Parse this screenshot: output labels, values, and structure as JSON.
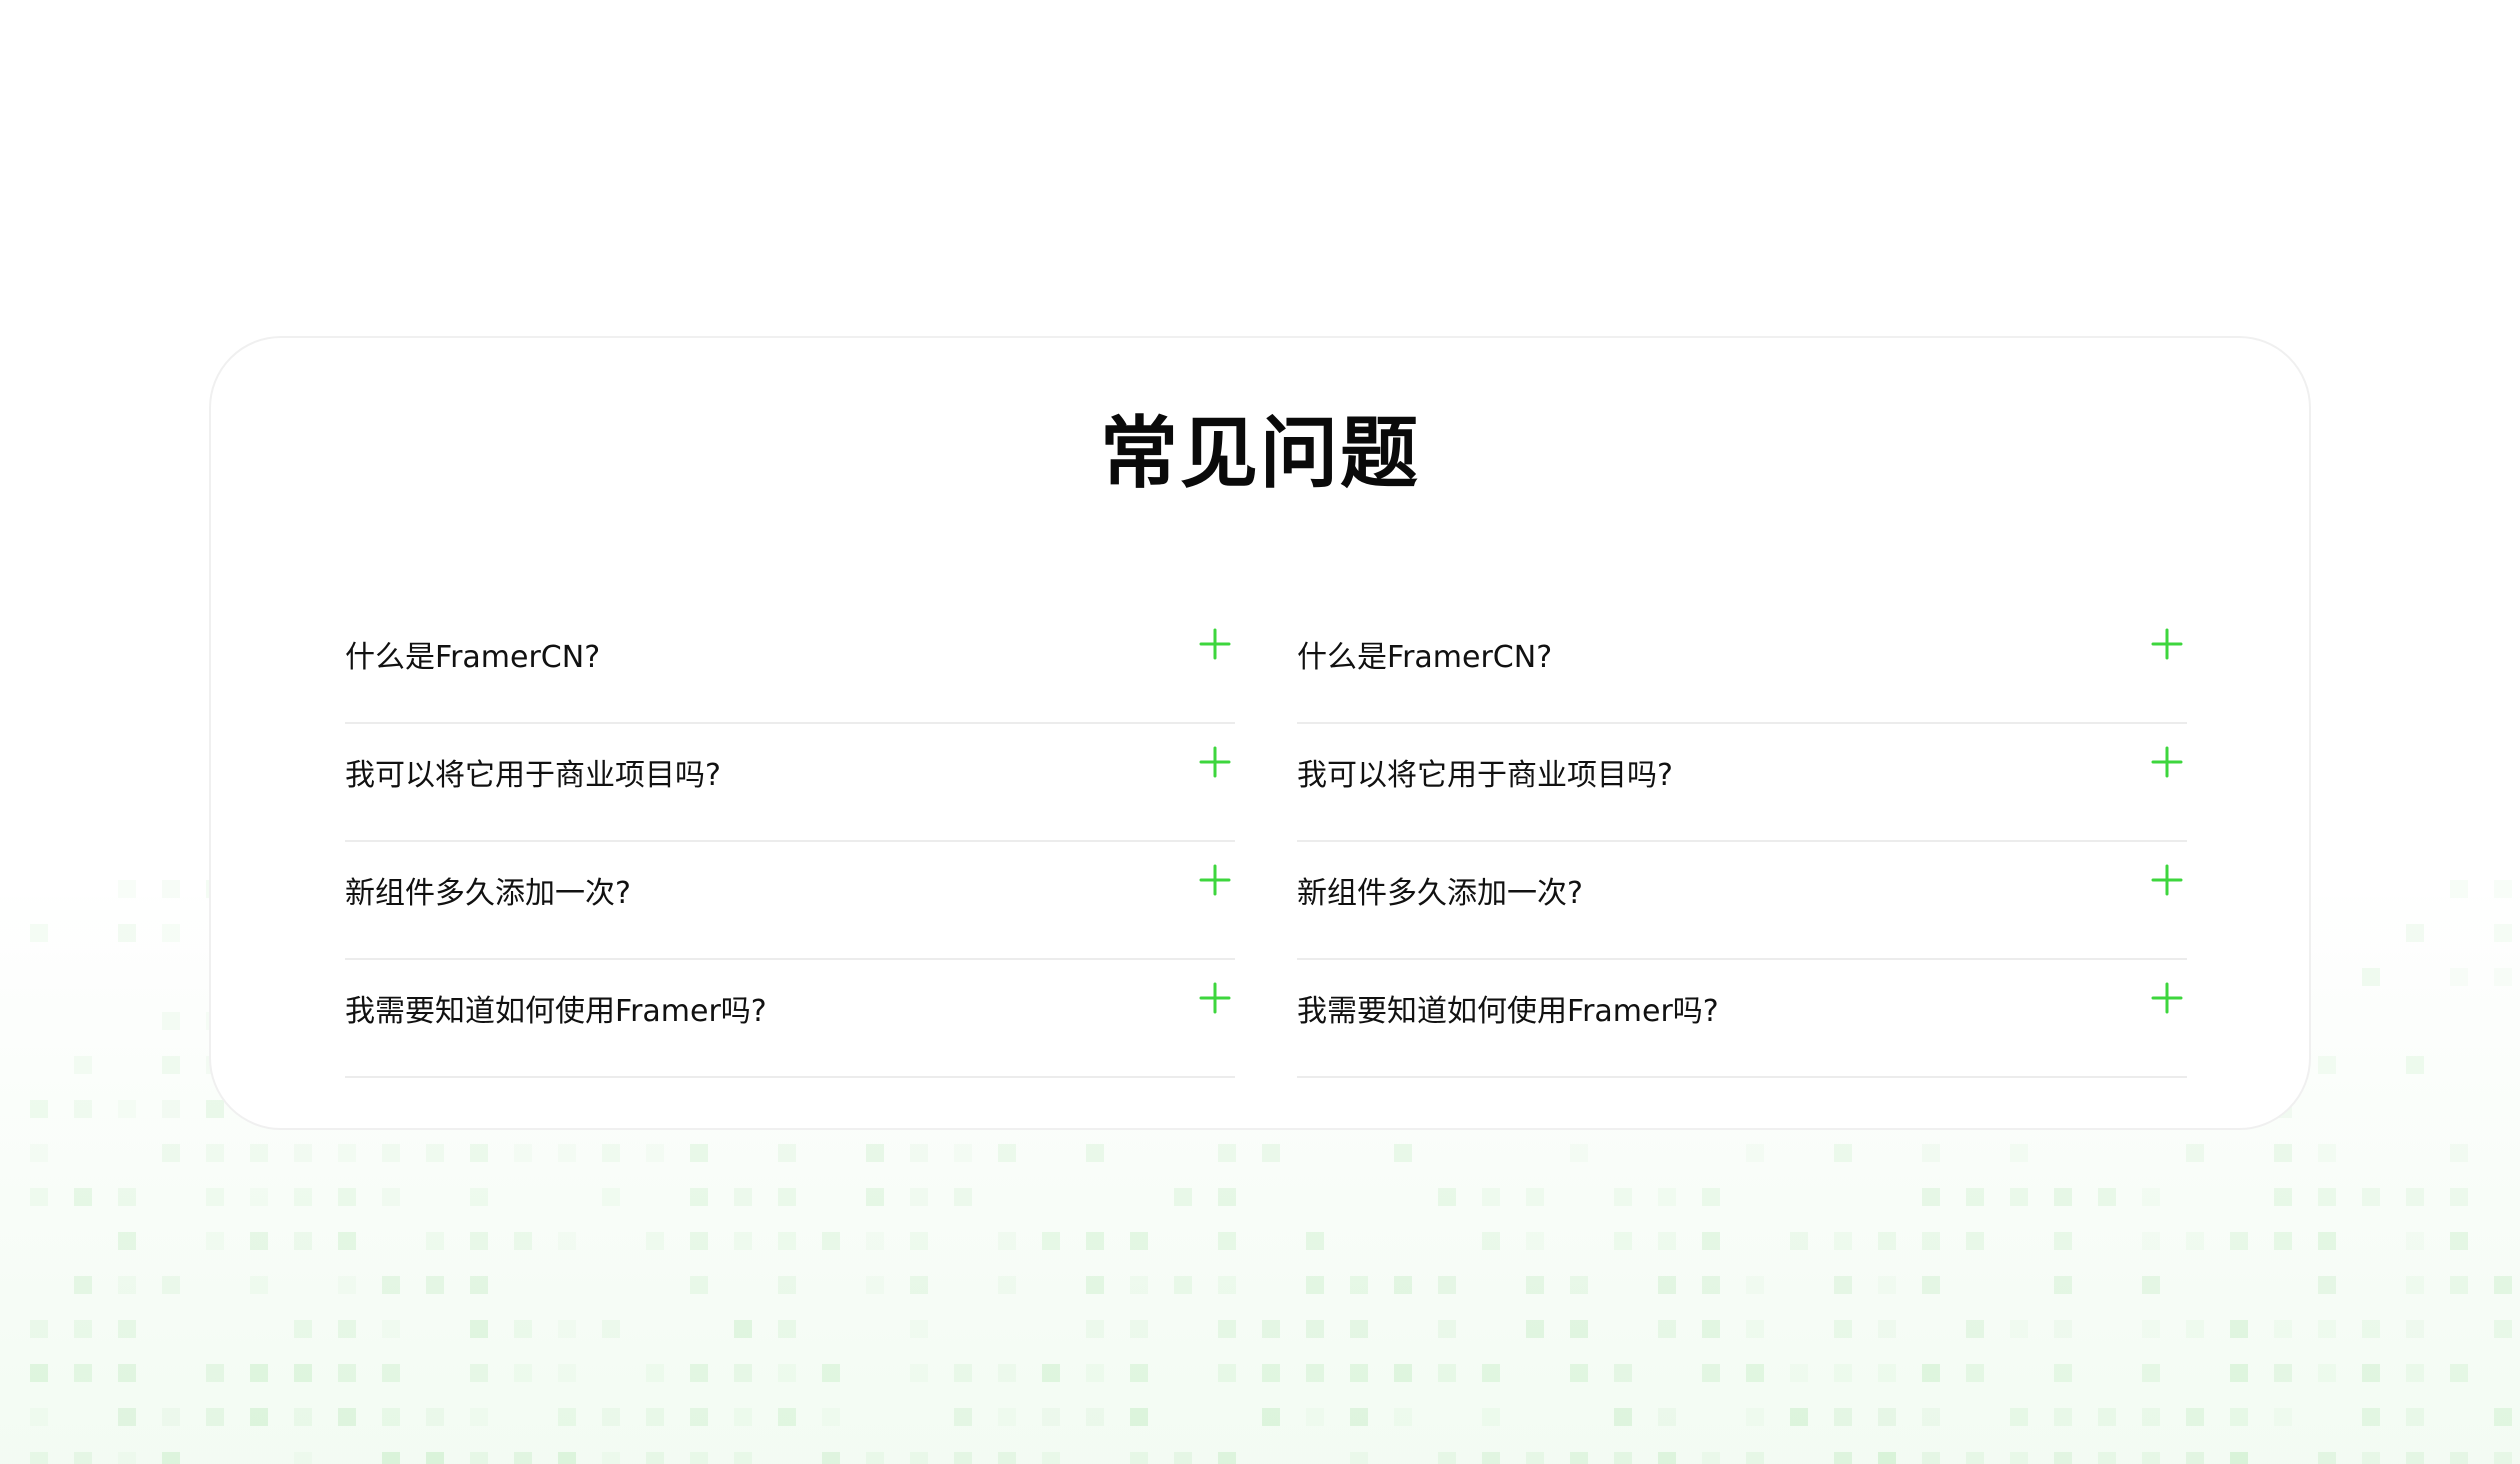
{
  "faq": {
    "title": "常见问题",
    "columns": [
      {
        "items": [
          {
            "question": "什么是FramerCN?"
          },
          {
            "question": "我可以将它用于商业项目吗?"
          },
          {
            "question": "新组件多久添加一次?"
          },
          {
            "question": "我需要知道如何使用Framer吗?"
          }
        ]
      },
      {
        "items": [
          {
            "question": "什么是FramerCN?"
          },
          {
            "question": "我可以将它用于商业项目吗?"
          },
          {
            "question": "新组件多久添加一次?"
          },
          {
            "question": "我需要知道如何使用Framer吗?"
          }
        ]
      }
    ],
    "expand_icon": "plus-icon"
  },
  "colors": {
    "accent": "#3dd63d",
    "background_pattern": "#4fc94f",
    "card_border": "#f0f0f0",
    "divider": "#ececec",
    "text": "#111111"
  }
}
